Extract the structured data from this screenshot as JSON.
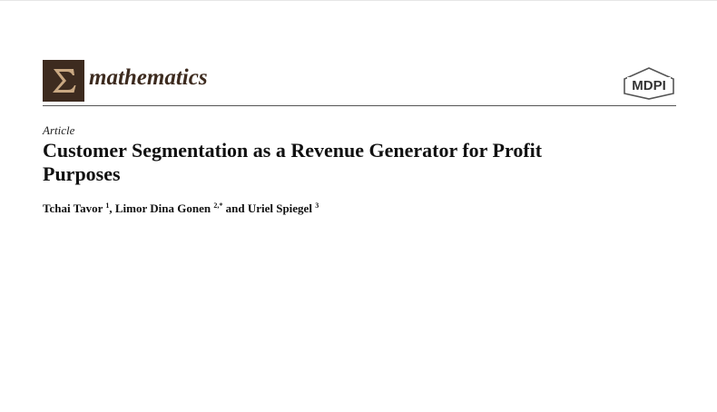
{
  "header": {
    "journal_logo_icon": "sigma-icon",
    "journal_logo_colors": {
      "background": "#3d2b1f",
      "glyph": "#c9a882"
    },
    "journal_name": "mathematics",
    "publisher_logo_text": "MDPI"
  },
  "article": {
    "type": "Article",
    "title": "Customer Segmentation as a Revenue Generator for Profit Purposes",
    "authors": [
      {
        "name": "Tchai Tavor",
        "affiliation": "1",
        "separator": ", "
      },
      {
        "name": "Limor Dina Gonen",
        "affiliation": "2,*",
        "separator": " and "
      },
      {
        "name": "Uriel Spiegel",
        "affiliation": "3",
        "separator": ""
      }
    ]
  }
}
